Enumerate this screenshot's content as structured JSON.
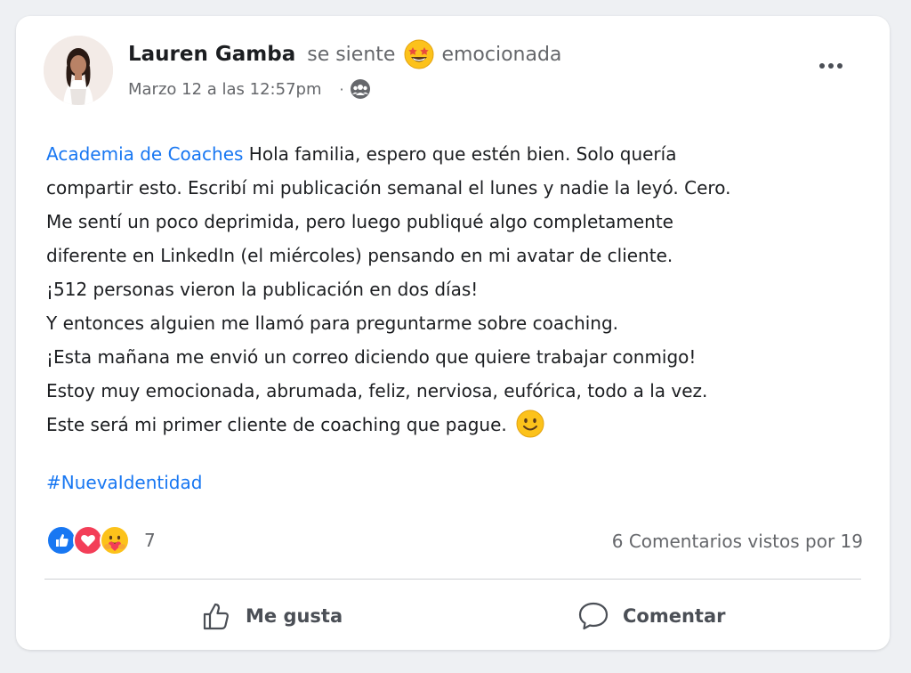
{
  "post": {
    "author": "Lauren Gamba",
    "feeling_prefix": "se siente",
    "feeling": "emocionada",
    "feeling_emoji": "star-struck-emoji",
    "timestamp": "Marzo 12 a las 12:57pm",
    "separator": "·",
    "audience_icon": "group-icon",
    "body": {
      "mention": "Academia de Coaches",
      "line1_rest": " Hola familia, espero que estén bien. Solo quería",
      "lines": [
        "compartir esto. Escribí mi publicación semanal el lunes y nadie la leyó. Cero.",
        "Me sentí un poco deprimida, pero luego publiqué algo completamente",
        "diferente en LinkedIn (el miércoles) pensando en mi avatar de cliente.",
        "¡512 personas vieron la publicación en dos días!",
        "Y entonces alguien me llamó para preguntarme sobre coaching.",
        "¡Esta mañana me envió un correo diciendo que quiere trabajar conmigo!",
        "Estoy muy emocionada, abrumada, feliz, nerviosa, eufórica, todo a la vez."
      ],
      "last_line": "Este será mi primer cliente de coaching que pague."
    },
    "hashtag": "#NuevaIdentidad"
  },
  "engagement": {
    "reaction_icons": [
      "like-icon",
      "love-icon",
      "care-icon"
    ],
    "reaction_count": "7",
    "stats": "6 Comentarios vistos por 19"
  },
  "actions": {
    "like_label": "Me gusta",
    "comment_label": "Comentar"
  },
  "colors": {
    "link": "#1877f2",
    "text": "#1c1e21",
    "secondary": "#65676b",
    "like_blue": "#1877f2",
    "love_red": "#f33e58",
    "care_yellow": "#f7b125"
  }
}
